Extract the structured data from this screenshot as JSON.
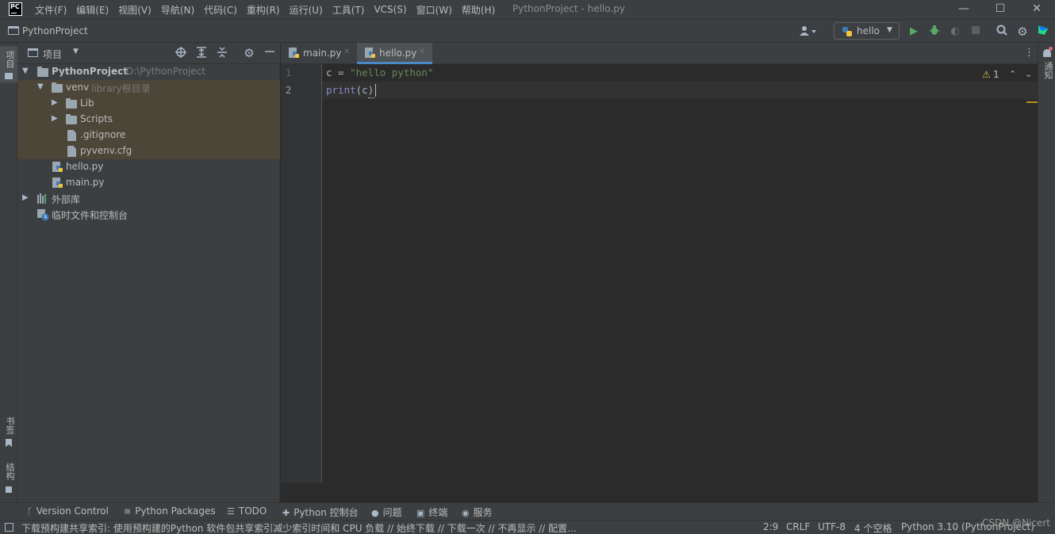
{
  "app": {
    "logo_text": "PC",
    "window_title": "PythonProject - hello.py",
    "menu": [
      "文件(F)",
      "编辑(E)",
      "视图(V)",
      "导航(N)",
      "代码(C)",
      "重构(R)",
      "运行(U)",
      "工具(T)",
      "VCS(S)",
      "窗口(W)",
      "帮助(H)"
    ],
    "win_minimize": "—",
    "win_maximize": "☐",
    "win_close": "✕"
  },
  "navbar": {
    "breadcrumb": "PythonProject",
    "run_config": "hello"
  },
  "stripes": {
    "left_project": "项目",
    "left_bookmarks": "书签",
    "left_structure": "结构",
    "right_notifications": "通知"
  },
  "project_panel": {
    "title": "项目",
    "tree": [
      {
        "label": "PythonProject",
        "hint": "D:\\PythonProject"
      },
      {
        "label": "venv",
        "hint": "library根目录"
      },
      {
        "label": "Lib"
      },
      {
        "label": "Scripts"
      },
      {
        "label": ".gitignore"
      },
      {
        "label": "pyvenv.cfg"
      },
      {
        "label": "hello.py"
      },
      {
        "label": "main.py"
      },
      {
        "label": "外部库"
      },
      {
        "label": "临时文件和控制台"
      }
    ]
  },
  "editor": {
    "tabs": [
      {
        "label": "main.py"
      },
      {
        "label": "hello.py"
      }
    ],
    "line_numbers": [
      "1",
      "2"
    ],
    "code": {
      "line1_var": "c = ",
      "line1_str": "\"hello python\"",
      "line2_fn": "print",
      "line2_args": "(c)"
    },
    "warning_count": "1"
  },
  "toolwindows": [
    "Version Control",
    "Python Packages",
    "TODO",
    "Python 控制台",
    "问题",
    "终端",
    "服务"
  ],
  "status": {
    "message": "下载预构建共享索引: 使用预构建的Python 软件包共享索引减少索引时间和 CPU 负载 // 始终下载 // 下载一次 // 不再显示 // 配置...",
    "position": "2:9",
    "line_sep": "CRLF",
    "encoding": "UTF-8",
    "indent": "4 个空格",
    "interpreter": "Python 3.10 (PythonProject)",
    "watermark": "CSDN @Nicert"
  },
  "colors": {
    "accent": "#4a88c7",
    "run_green": "#59a869",
    "warning": "#d6bf55"
  }
}
